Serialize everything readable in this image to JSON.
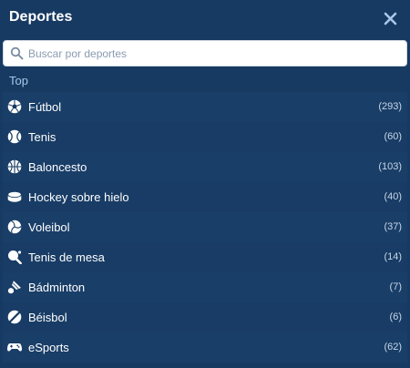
{
  "header": {
    "title": "Deportes"
  },
  "search": {
    "placeholder": "Buscar por deportes",
    "value": ""
  },
  "section": {
    "label": "Top"
  },
  "sports": [
    {
      "name": "Fútbol",
      "count": "(293)",
      "icon": "soccer-ball-icon"
    },
    {
      "name": "Tenis",
      "count": "(60)",
      "icon": "tennis-ball-icon"
    },
    {
      "name": "Baloncesto",
      "count": "(103)",
      "icon": "basketball-icon"
    },
    {
      "name": "Hockey sobre hielo",
      "count": "(40)",
      "icon": "hockey-puck-icon"
    },
    {
      "name": "Voleibol",
      "count": "(37)",
      "icon": "volleyball-icon"
    },
    {
      "name": "Tenis de mesa",
      "count": "(14)",
      "icon": "table-tennis-icon"
    },
    {
      "name": "Bádminton",
      "count": "(7)",
      "icon": "shuttlecock-icon"
    },
    {
      "name": "Béisbol",
      "count": "(6)",
      "icon": "baseball-icon"
    },
    {
      "name": "eSports",
      "count": "(62)",
      "icon": "gamepad-icon"
    }
  ],
  "colors": {
    "background": "#173a62",
    "section": "#a9c7ea",
    "text": "#ffffff"
  }
}
